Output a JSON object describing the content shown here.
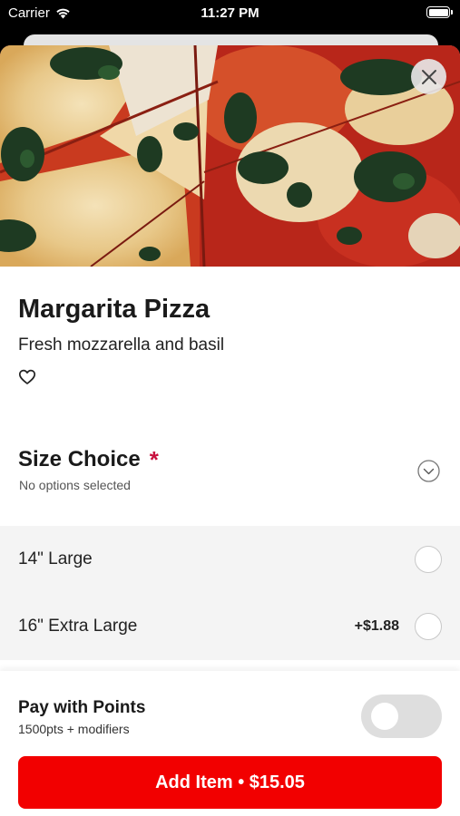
{
  "status_bar": {
    "carrier": "Carrier",
    "time": "11:27 PM"
  },
  "item": {
    "title": "Margarita Pizza",
    "description": "Fresh mozzarella and basil",
    "favorite_icon": "heart-outline-icon",
    "close_icon": "close-icon"
  },
  "size_choice": {
    "title": "Size Choice",
    "required_marker": "*",
    "status": "No options selected",
    "expand_icon": "chevron-down-circle-icon",
    "options": [
      {
        "label": "14\" Large",
        "price": "",
        "selected": false
      },
      {
        "label": "16\" Extra Large",
        "price": "+$1.88",
        "selected": false
      }
    ]
  },
  "points": {
    "title": "Pay with Points",
    "subtitle": "1500pts + modifiers",
    "enabled": false
  },
  "add_button": {
    "label": "Add Item • $15.05"
  },
  "colors": {
    "accent": "#f20000",
    "required": "#c8103e",
    "toggle_off": "#dedede"
  }
}
